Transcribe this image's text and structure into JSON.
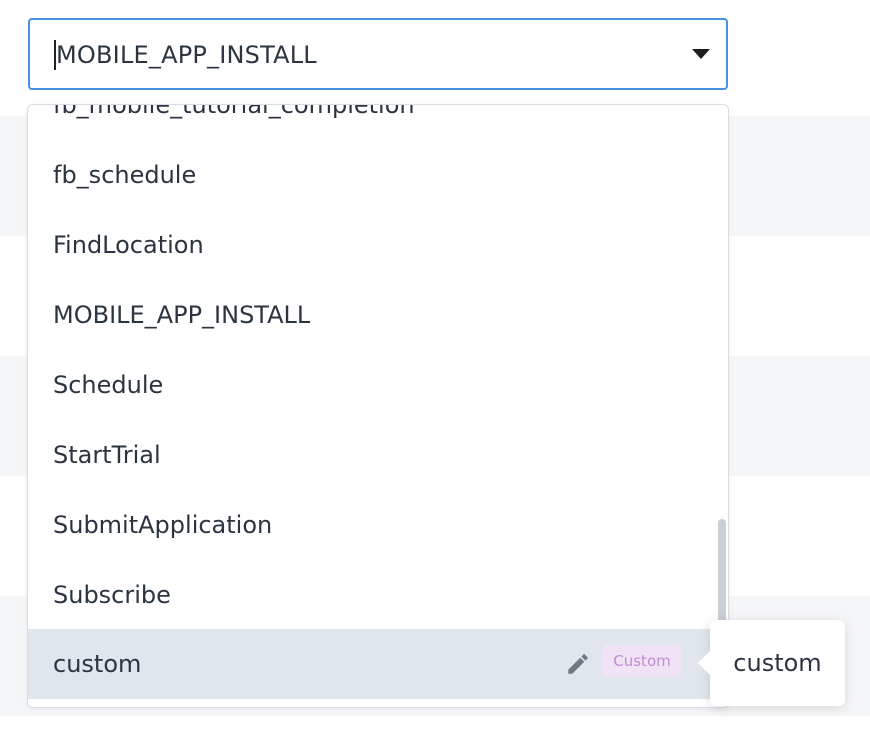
{
  "select": {
    "value": "MOBILE_APP_INSTALL"
  },
  "menu": {
    "clipped_item": "fb_mobile_tutorial_completion",
    "items": [
      "fb_schedule",
      "FindLocation",
      "MOBILE_APP_INSTALL",
      "Schedule",
      "StartTrial",
      "SubmitApplication",
      "Subscribe"
    ],
    "selected_item": {
      "label": "custom",
      "badge": "Custom",
      "icon": "edit-icon"
    }
  },
  "tooltip": {
    "text": "custom"
  },
  "colors": {
    "focus_border": "#4a90e2",
    "selected_bg": "#e1e6ec",
    "badge_bg": "#f1e3f6",
    "badge_text": "#c38bd6"
  }
}
